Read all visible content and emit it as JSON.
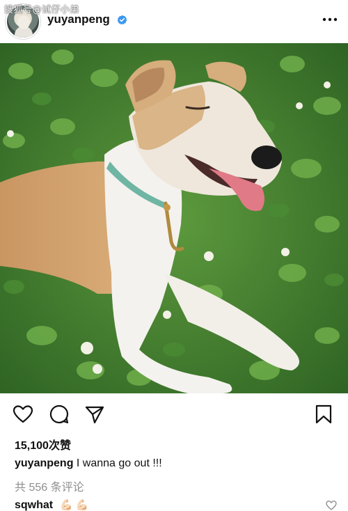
{
  "watermark": "搜狐号@试仔小弟",
  "post": {
    "username": "yuyanpeng",
    "likes": "15,100次赞",
    "caption_user": "yuyanpeng",
    "caption_text": " I wanna go out !!!",
    "comments_link": "共 556 条评论"
  },
  "comment": {
    "username": "sqwhat",
    "emoji": "💪🏻💪🏻"
  },
  "icons": {
    "verified": "verified-badge-icon",
    "more": "more-options-icon",
    "like": "heart-icon",
    "comment": "comment-bubble-icon",
    "share": "send-paper-plane-icon",
    "save": "bookmark-icon",
    "comment_like": "small-heart-icon"
  },
  "colors": {
    "verified_blue": "#3897f0",
    "text": "#111111",
    "muted": "#8e8e8e",
    "grass": "#3f7a2f"
  }
}
